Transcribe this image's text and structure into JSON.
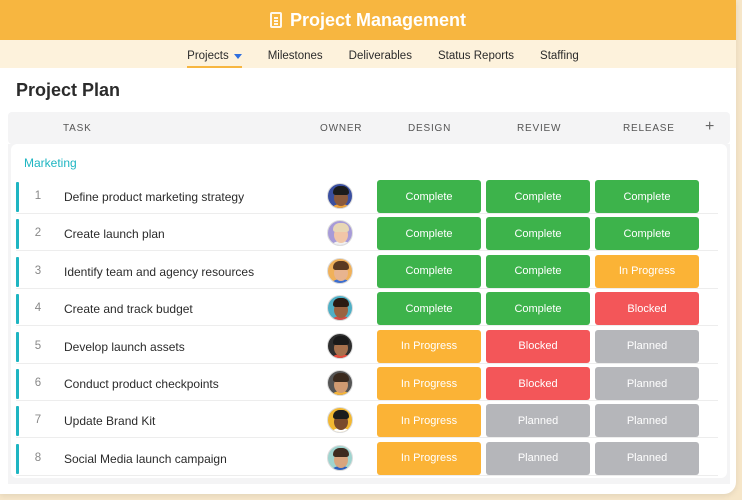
{
  "app": {
    "title": "Project Management"
  },
  "nav": {
    "items": [
      {
        "label": "Projects",
        "active": true
      },
      {
        "label": "Milestones",
        "active": false
      },
      {
        "label": "Deliverables",
        "active": false
      },
      {
        "label": "Status Reports",
        "active": false
      },
      {
        "label": "Staffing",
        "active": false
      }
    ]
  },
  "page": {
    "title": "Project Plan"
  },
  "columns": {
    "task": "TASK",
    "owner": "OWNER",
    "design": "DESIGN",
    "review": "REVIEW",
    "release": "RELEASE",
    "add": "+"
  },
  "section": {
    "label": "Marketing"
  },
  "status_colors": {
    "Complete": "#3db34b",
    "In Progress": "#fbb336",
    "Blocked": "#f35659",
    "Planned": "#b5b6ba"
  },
  "rows": [
    {
      "num": "1",
      "task": "Define product marketing strategy",
      "design": "Complete",
      "review": "Complete",
      "release": "Complete"
    },
    {
      "num": "2",
      "task": "Create launch plan",
      "design": "Complete",
      "review": "Complete",
      "release": "Complete"
    },
    {
      "num": "3",
      "task": "Identify team and agency resources",
      "design": "Complete",
      "review": "Complete",
      "release": "In Progress"
    },
    {
      "num": "4",
      "task": "Create and track budget",
      "design": "Complete",
      "review": "Complete",
      "release": "Blocked"
    },
    {
      "num": "5",
      "task": "Develop launch assets",
      "design": "In Progress",
      "review": "Blocked",
      "release": "Planned"
    },
    {
      "num": "6",
      "task": "Conduct product checkpoints",
      "design": "In Progress",
      "review": "Blocked",
      "release": "Planned"
    },
    {
      "num": "7",
      "task": "Update Brand Kit",
      "design": "In Progress",
      "review": "Planned",
      "release": "Planned"
    },
    {
      "num": "8",
      "task": "Social Media launch campaign",
      "design": "In Progress",
      "review": "Planned",
      "release": "Planned"
    }
  ]
}
